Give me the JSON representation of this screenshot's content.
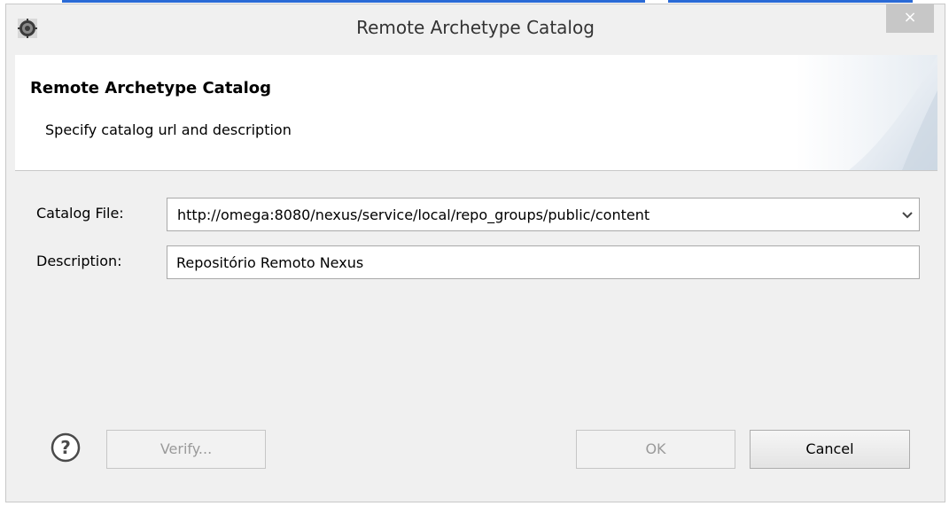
{
  "window": {
    "title": "Remote Archetype Catalog",
    "close_label": "×"
  },
  "header": {
    "title": "Remote Archetype Catalog",
    "description": "Specify catalog url and description"
  },
  "form": {
    "catalog_file_label": "Catalog File:",
    "catalog_file_value": "http://omega:8080/nexus/service/local/repo_groups/public/content",
    "description_label": "Description:",
    "description_value": "Repositório Remoto Nexus"
  },
  "buttons": {
    "verify_label": "Verify...",
    "ok_label": "OK",
    "cancel_label": "Cancel"
  },
  "icons": {
    "app": "eclipse-gear-icon",
    "help": "question-mark-help-icon",
    "dropdown": "chevron-down-icon"
  },
  "colors": {
    "link_line": "#2a6ad6",
    "disabled_text": "#9a9a9a"
  }
}
